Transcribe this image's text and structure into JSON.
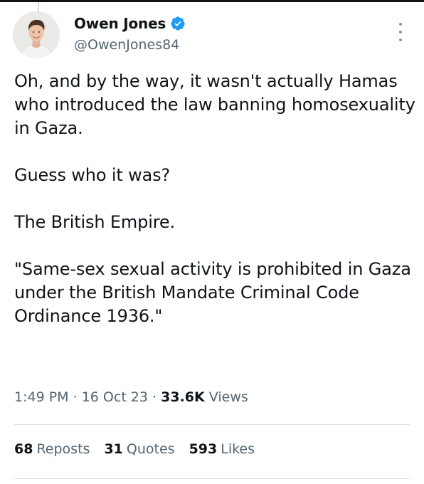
{
  "author": {
    "display_name": "Owen Jones",
    "handle": "@OwenJones84",
    "verified_icon": "verified-badge-icon",
    "verified_color": "#1d9bf0"
  },
  "tweet": {
    "paragraphs": [
      "Oh, and by the way, it wasn't actually Hamas who introduced the law banning homosexuality in Gaza.",
      "Guess who it was?",
      "The British Empire.",
      "\"Same-sex sexual activity is prohibited in Gaza under the British Mandate Criminal Code Ordinance 1936.\""
    ]
  },
  "meta": {
    "time": "1:49 PM",
    "separator": "·",
    "date": "16 Oct 23",
    "views_count": "33.6K",
    "views_label": "Views"
  },
  "stats": {
    "reposts_count": "68",
    "reposts_label": "Reposts",
    "quotes_count": "31",
    "quotes_label": "Quotes",
    "likes_count": "593",
    "likes_label": "Likes"
  },
  "colors": {
    "text": "#0f1419",
    "secondary": "#536471",
    "divider": "#d9dfe3"
  }
}
